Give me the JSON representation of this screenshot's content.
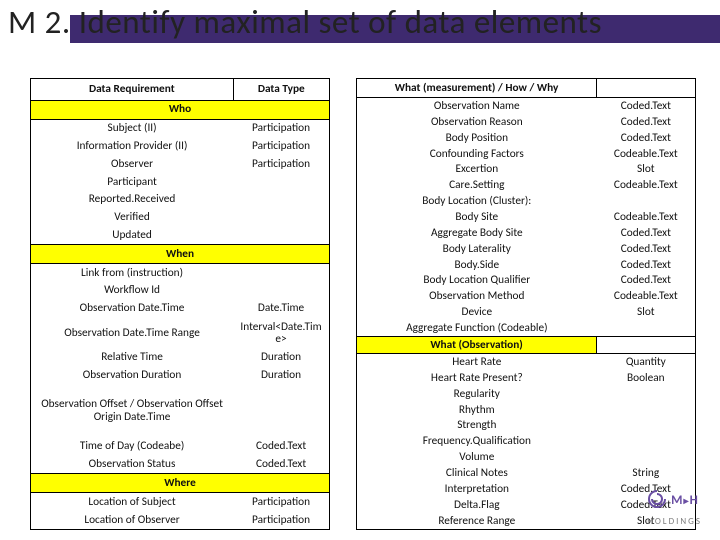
{
  "title": "M 2. Identify maximal set of data elements",
  "left_table": {
    "headers": [
      "Data Requirement",
      "Data Type"
    ],
    "sections": [
      {
        "label": "Who",
        "rows": [
          [
            "Subject (II)",
            "Participation"
          ],
          [
            "Information Provider (II)",
            "Participation"
          ],
          [
            "Observer",
            "Participation"
          ],
          [
            "Participant",
            ""
          ],
          [
            "Reported.Received",
            ""
          ],
          [
            "Verified",
            ""
          ],
          [
            "Updated",
            ""
          ]
        ]
      },
      {
        "label": "When",
        "rows": [
          [
            "Link from (instruction)",
            ""
          ],
          [
            "Workflow Id",
            ""
          ],
          [
            "Observation Date.Time",
            "Date.Time"
          ],
          [
            "Observation Date.Time Range",
            "Interval<Date.Tim e>"
          ],
          [
            "Relative Time",
            "Duration"
          ],
          [
            "Observation Duration",
            "Duration"
          ],
          [
            "Observation Offset / Observation Offset Origin Date.Time",
            ""
          ],
          [
            "Time of Day (Codeabe)",
            "Coded.Text"
          ],
          [
            "Observation Status",
            "Coded.Text"
          ]
        ]
      },
      {
        "label": "Where",
        "rows": [
          [
            "Location of Subject",
            "Participation"
          ],
          [
            "Location of Observer",
            "Participation"
          ]
        ]
      }
    ]
  },
  "right_table": {
    "headers": [
      "What (measurement) / How / Why",
      ""
    ],
    "rows_top": [
      [
        "Observation Name",
        "Coded.Text"
      ],
      [
        "Observation Reason",
        "Coded.Text"
      ],
      [
        "Body Position",
        "Coded.Text"
      ],
      [
        "Confounding Factors",
        "Codeable.Text"
      ],
      [
        "Excertion",
        "Slot"
      ],
      [
        "Care.Setting",
        "Codeable.Text"
      ],
      [
        "Body Location (Cluster):",
        ""
      ],
      [
        "Body Site",
        "Codeable.Text"
      ],
      [
        "Aggregate Body Site",
        "Coded.Text"
      ],
      [
        "Body Laterality",
        "Coded.Text"
      ],
      [
        "Body.Side",
        "Coded.Text"
      ],
      [
        "Body Location Qualifier",
        "Coded.Text"
      ],
      [
        "Observation Method",
        "Codeable.Text"
      ],
      [
        "Device",
        "Slot"
      ],
      [
        "Aggregate Function (Codeable)",
        ""
      ]
    ],
    "section2": "What (Observation)",
    "rows_bottom": [
      [
        "Heart Rate",
        "Quantity"
      ],
      [
        "Heart Rate Present?",
        "Boolean"
      ],
      [
        "Regularity",
        ""
      ],
      [
        "Rhythm",
        ""
      ],
      [
        "Strength",
        ""
      ],
      [
        "Frequency.Qualification",
        ""
      ],
      [
        "Volume",
        ""
      ],
      [
        "Clinical Notes",
        "String"
      ],
      [
        "Interpretation",
        "Coded.Text"
      ],
      [
        "Delta.Flag",
        "Coded.Text"
      ],
      [
        "Reference Range",
        "Slot"
      ]
    ]
  },
  "logo": {
    "main": "M",
    "sub": "HOLDINGS",
    "h": "H"
  }
}
